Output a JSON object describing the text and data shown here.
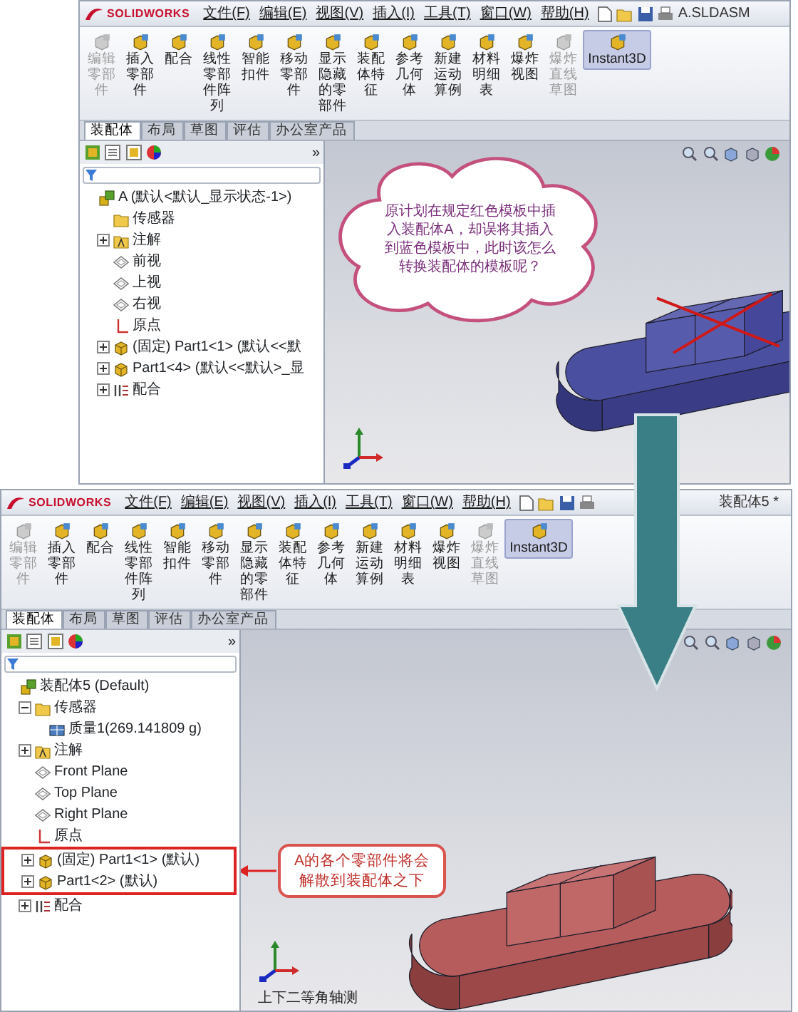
{
  "top_window": {
    "logo": "SOLIDWORKS",
    "menus": [
      "文件(F)",
      "编辑(E)",
      "视图(V)",
      "插入(I)",
      "工具(T)",
      "窗口(W)",
      "帮助(H)"
    ],
    "window_title": "A.SLDASM",
    "toolbar": [
      {
        "label": "编辑零部件",
        "disabled": true,
        "active": false
      },
      {
        "label": "插入零部件",
        "disabled": false,
        "active": false
      },
      {
        "label": "配合",
        "disabled": false,
        "active": false
      },
      {
        "label": "线性零部件阵列",
        "disabled": false,
        "active": false
      },
      {
        "label": "智能扣件",
        "disabled": false,
        "active": false
      },
      {
        "label": "移动零部件",
        "disabled": false,
        "active": false
      },
      {
        "label": "显示隐藏的零部件",
        "disabled": false,
        "active": false
      },
      {
        "label": "装配体特征",
        "disabled": false,
        "active": false
      },
      {
        "label": "参考几何体",
        "disabled": false,
        "active": false
      },
      {
        "label": "新建运动算例",
        "disabled": false,
        "active": false
      },
      {
        "label": "材料明细表",
        "disabled": false,
        "active": false
      },
      {
        "label": "爆炸视图",
        "disabled": false,
        "active": false
      },
      {
        "label": "爆炸直线草图",
        "disabled": true,
        "active": false
      },
      {
        "label": "Instant3D",
        "disabled": false,
        "active": true
      }
    ],
    "tabs": [
      {
        "label": "装配体",
        "selected": true
      },
      {
        "label": "布局",
        "selected": false
      },
      {
        "label": "草图",
        "selected": false
      },
      {
        "label": "评估",
        "selected": false
      },
      {
        "label": "办公室产品",
        "selected": false
      }
    ],
    "panel_toggle": "»",
    "tree": {
      "label": "A (默认<默认_显示状态-1>)",
      "kind": "assembly",
      "children": [
        {
          "label": "传感器",
          "kind": "folder"
        },
        {
          "label": "注解",
          "kind": "annotation",
          "expanded": false
        },
        {
          "label": "前视",
          "kind": "plane"
        },
        {
          "label": "上视",
          "kind": "plane"
        },
        {
          "label": "右视",
          "kind": "plane"
        },
        {
          "label": "原点",
          "kind": "origin"
        },
        {
          "label": "(固定) Part1<1> (默认<<默",
          "kind": "part",
          "expanded": false
        },
        {
          "label": "Part1<4> (默认<<默认>_显",
          "kind": "part",
          "expanded": false
        },
        {
          "label": "配合",
          "kind": "mates",
          "expanded": false
        }
      ]
    },
    "viewport": {
      "callout": "原计划在规定红色模板中插入装配体A，却误将其插入到蓝色模板中，此时该怎么转换装配体的模板呢？",
      "crossed_out": true
    }
  },
  "bottom_window": {
    "logo": "SOLIDWORKS",
    "menus": [
      "文件(F)",
      "编辑(E)",
      "视图(V)",
      "插入(I)",
      "工具(T)",
      "窗口(W)",
      "帮助(H)"
    ],
    "window_title": "装配体5 *",
    "toolbar": [
      {
        "label": "编辑零部件",
        "disabled": true,
        "active": false
      },
      {
        "label": "插入零部件",
        "disabled": false,
        "active": false
      },
      {
        "label": "配合",
        "disabled": false,
        "active": false
      },
      {
        "label": "线性零部件阵列",
        "disabled": false,
        "active": false
      },
      {
        "label": "智能扣件",
        "disabled": false,
        "active": false
      },
      {
        "label": "移动零部件",
        "disabled": false,
        "active": false
      },
      {
        "label": "显示隐藏的零部件",
        "disabled": false,
        "active": false
      },
      {
        "label": "装配体特征",
        "disabled": false,
        "active": false
      },
      {
        "label": "参考几何体",
        "disabled": false,
        "active": false
      },
      {
        "label": "新建运动算例",
        "disabled": false,
        "active": false
      },
      {
        "label": "材料明细表",
        "disabled": false,
        "active": false
      },
      {
        "label": "爆炸视图",
        "disabled": false,
        "active": false
      },
      {
        "label": "爆炸直线草图",
        "disabled": true,
        "active": false
      },
      {
        "label": "Instant3D",
        "disabled": false,
        "active": true
      }
    ],
    "tabs": [
      {
        "label": "装配体",
        "selected": true
      },
      {
        "label": "布局",
        "selected": false
      },
      {
        "label": "草图",
        "selected": false
      },
      {
        "label": "评估",
        "selected": false
      },
      {
        "label": "办公室产品",
        "selected": false
      }
    ],
    "panel_toggle": "»",
    "tree": {
      "label": "装配体5 (Default)",
      "kind": "assembly",
      "children": [
        {
          "label": "传感器",
          "kind": "folder",
          "expanded": true,
          "outlined": false,
          "children": [
            {
              "label": "质量1(269.141809 g)",
              "kind": "mass"
            }
          ]
        },
        {
          "label": "注解",
          "kind": "annotation",
          "expanded": false,
          "outlined": false
        },
        {
          "label": "Front Plane",
          "kind": "plane",
          "outlined": false
        },
        {
          "label": "Top Plane",
          "kind": "plane",
          "outlined": false
        },
        {
          "label": "Right Plane",
          "kind": "plane",
          "outlined": false
        },
        {
          "label": "原点",
          "kind": "origin",
          "outlined": false
        },
        {
          "label": "(固定) Part1<1> (默认)",
          "kind": "part",
          "expanded": false,
          "outlined": true
        },
        {
          "label": "Part1<2> (默认)",
          "kind": "part",
          "expanded": false,
          "outlined": true
        },
        {
          "label": "配合",
          "kind": "mates",
          "expanded": false,
          "outlined": false
        }
      ]
    },
    "viewport": {
      "annotation": "A的各个零部件将会解散到装配体之下",
      "view_name": "上下二等角轴测"
    }
  }
}
